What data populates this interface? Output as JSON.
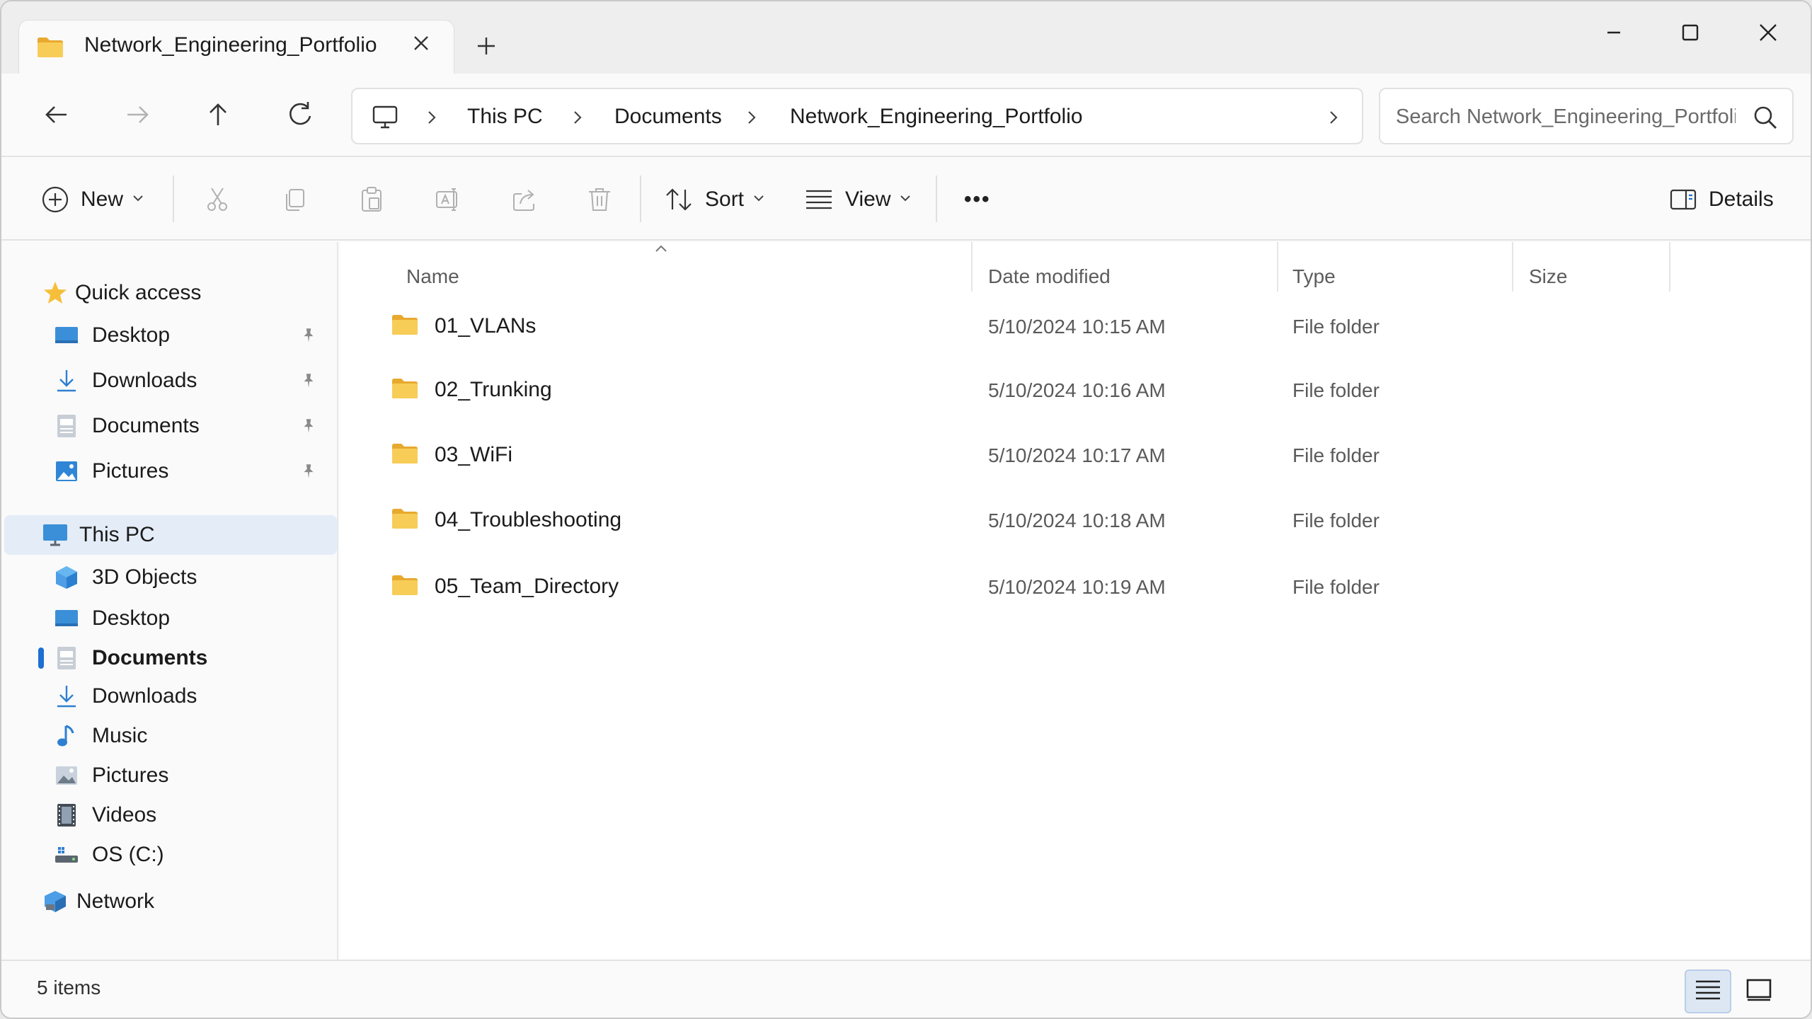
{
  "tab": {
    "title": "Network_Engineering_Portfolio"
  },
  "address": {
    "segments": [
      "This PC",
      "Documents",
      "Network_Engineering_Portfolio"
    ]
  },
  "search": {
    "placeholder": "Search Network_Engineering_Portfolio"
  },
  "toolbar": {
    "new_label": "New",
    "sort_label": "Sort",
    "view_label": "View",
    "more_label": "•••",
    "details_label": "Details"
  },
  "sidebar": {
    "quick_access": {
      "label": "Quick access",
      "items": [
        {
          "label": "Desktop",
          "icon": "desktop-icon",
          "pinned": true
        },
        {
          "label": "Downloads",
          "icon": "download-icon",
          "pinned": true
        },
        {
          "label": "Documents",
          "icon": "documents-icon",
          "pinned": true
        },
        {
          "label": "Pictures",
          "icon": "pictures-icon",
          "pinned": true
        }
      ]
    },
    "this_pc": {
      "label": "This PC",
      "items": [
        {
          "label": "3D Objects",
          "icon": "3d-objects-icon"
        },
        {
          "label": "Desktop",
          "icon": "desktop-icon"
        },
        {
          "label": "Documents",
          "icon": "documents-icon",
          "selected": true
        },
        {
          "label": "Downloads",
          "icon": "download-icon"
        },
        {
          "label": "Music",
          "icon": "music-icon"
        },
        {
          "label": "Pictures",
          "icon": "pictures-icon"
        },
        {
          "label": "Videos",
          "icon": "videos-icon"
        },
        {
          "label": "OS (C:)",
          "icon": "drive-icon"
        }
      ]
    },
    "network": {
      "label": "Network",
      "icon": "network-icon"
    }
  },
  "columns": {
    "name": "Name",
    "date": "Date modified",
    "type": "Type",
    "size": "Size"
  },
  "files": [
    {
      "name": "01_VLANs",
      "date": "5/10/2024  10:15 AM",
      "type": "File folder",
      "size": ""
    },
    {
      "name": "02_Trunking",
      "date": "5/10/2024  10:16 AM",
      "type": "File folder",
      "size": ""
    },
    {
      "name": "03_WiFi",
      "date": "5/10/2024  10:17 AM",
      "type": "File folder",
      "size": ""
    },
    {
      "name": "04_Troubleshooting",
      "date": "5/10/2024  10:18 AM",
      "type": "File folder",
      "size": ""
    },
    {
      "name": "05_Team_Directory",
      "date": "5/10/2024  10:19 AM",
      "type": "File folder",
      "size": ""
    }
  ],
  "status": {
    "item_count": "5 items"
  },
  "colors": {
    "accent": "#1d6fd1",
    "folder": "#f4c752",
    "selection": "#e4ecf7"
  }
}
